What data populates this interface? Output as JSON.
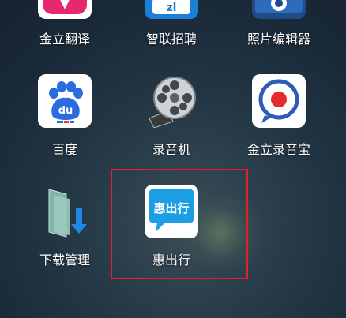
{
  "apps": [
    {
      "label": "金立翻译",
      "icon": "translate-icon"
    },
    {
      "label": "智联招聘",
      "icon": "zhaopin-icon"
    },
    {
      "label": "照片编辑器",
      "icon": "photo-editor-icon"
    },
    {
      "label": "百度",
      "icon": "baidu-icon",
      "icon_text": "du"
    },
    {
      "label": "录音机",
      "icon": "film-reel-icon"
    },
    {
      "label": "金立录音宝",
      "icon": "record-icon"
    },
    {
      "label": "下载管理",
      "icon": "download-folder-icon"
    },
    {
      "label": "惠出行",
      "icon": "huichuxing-icon",
      "icon_text": "惠出行"
    }
  ],
  "colors": {
    "highlight_border": "#e32027",
    "translate_bg": "#e8286e",
    "baidu_blue": "#2a6ce0",
    "record_red": "#e52a2a",
    "huichuxing_blue": "#1c9de4"
  }
}
